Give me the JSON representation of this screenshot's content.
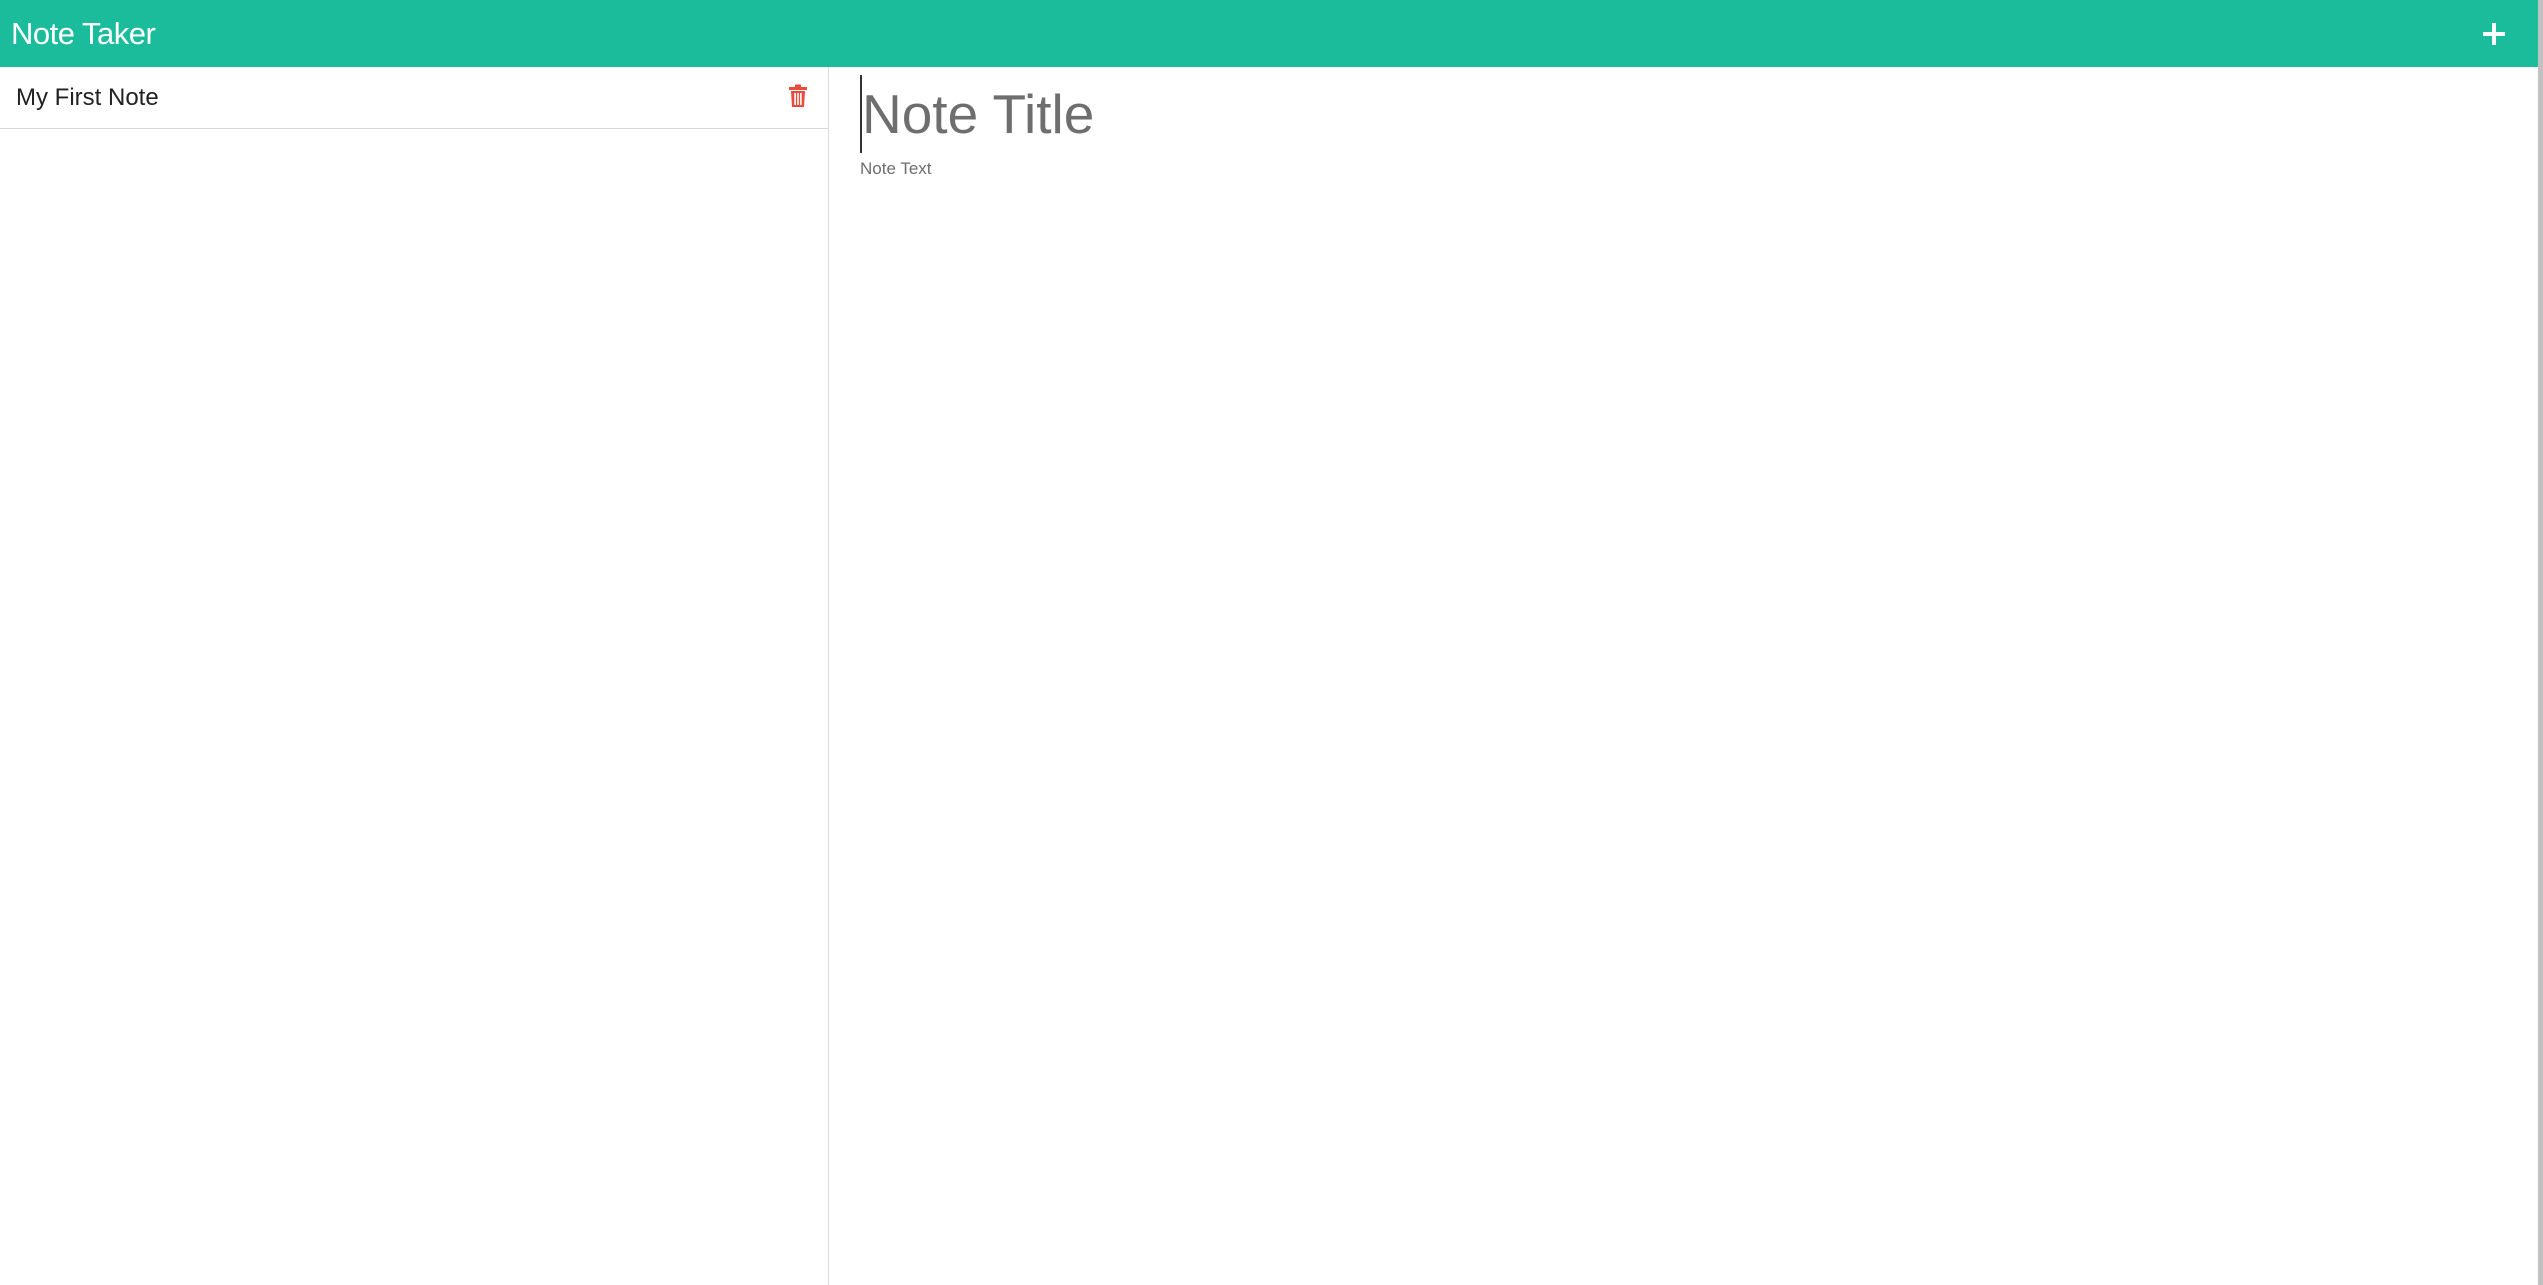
{
  "navbar": {
    "brand": "Note Taker",
    "new_note_icon": "plus-icon",
    "background": "#1abc9c"
  },
  "sidebar": {
    "notes": [
      {
        "title": "My First Note",
        "delete_icon": "trash-icon",
        "delete_color": "#e74c3c"
      }
    ]
  },
  "editor": {
    "title_placeholder": "Note Title",
    "text_placeholder": "Note Text"
  }
}
